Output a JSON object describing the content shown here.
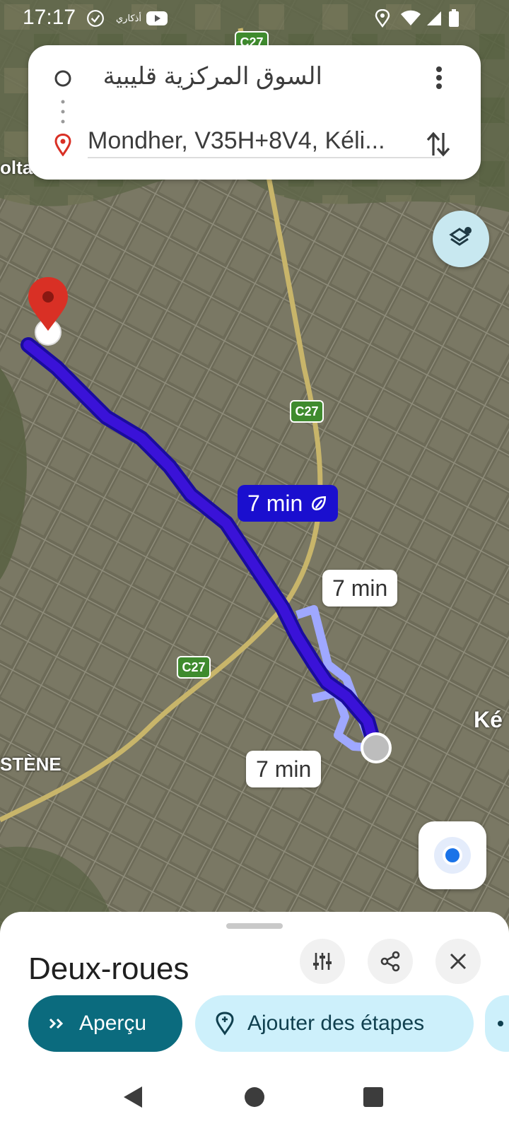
{
  "status_bar": {
    "time": "17:17",
    "app_label": "أذكاري"
  },
  "search": {
    "origin": "السوق المركزية قليبية",
    "destination": "Mondher, V35H+8V4, Kéli..."
  },
  "map": {
    "road_labels": [
      "C27",
      "C27",
      "C27"
    ],
    "place_labels": [
      "oltan",
      "STÈNE",
      "Ké"
    ],
    "route_times": {
      "primary": "7 min",
      "alt1": "7 min",
      "alt2": "7 min"
    },
    "colors": {
      "route_primary": "#3a12d8",
      "route_alt": "#9fa8ff",
      "pin": "#d93025"
    }
  },
  "sheet": {
    "title": "Deux-roues",
    "overview_label": "Aperçu",
    "add_stops_label": "Ajouter des étapes"
  },
  "colors": {
    "accent": "#0b6b7e",
    "pill_secondary": "#cdf0fb",
    "layers_button": "#c8e8f0"
  }
}
